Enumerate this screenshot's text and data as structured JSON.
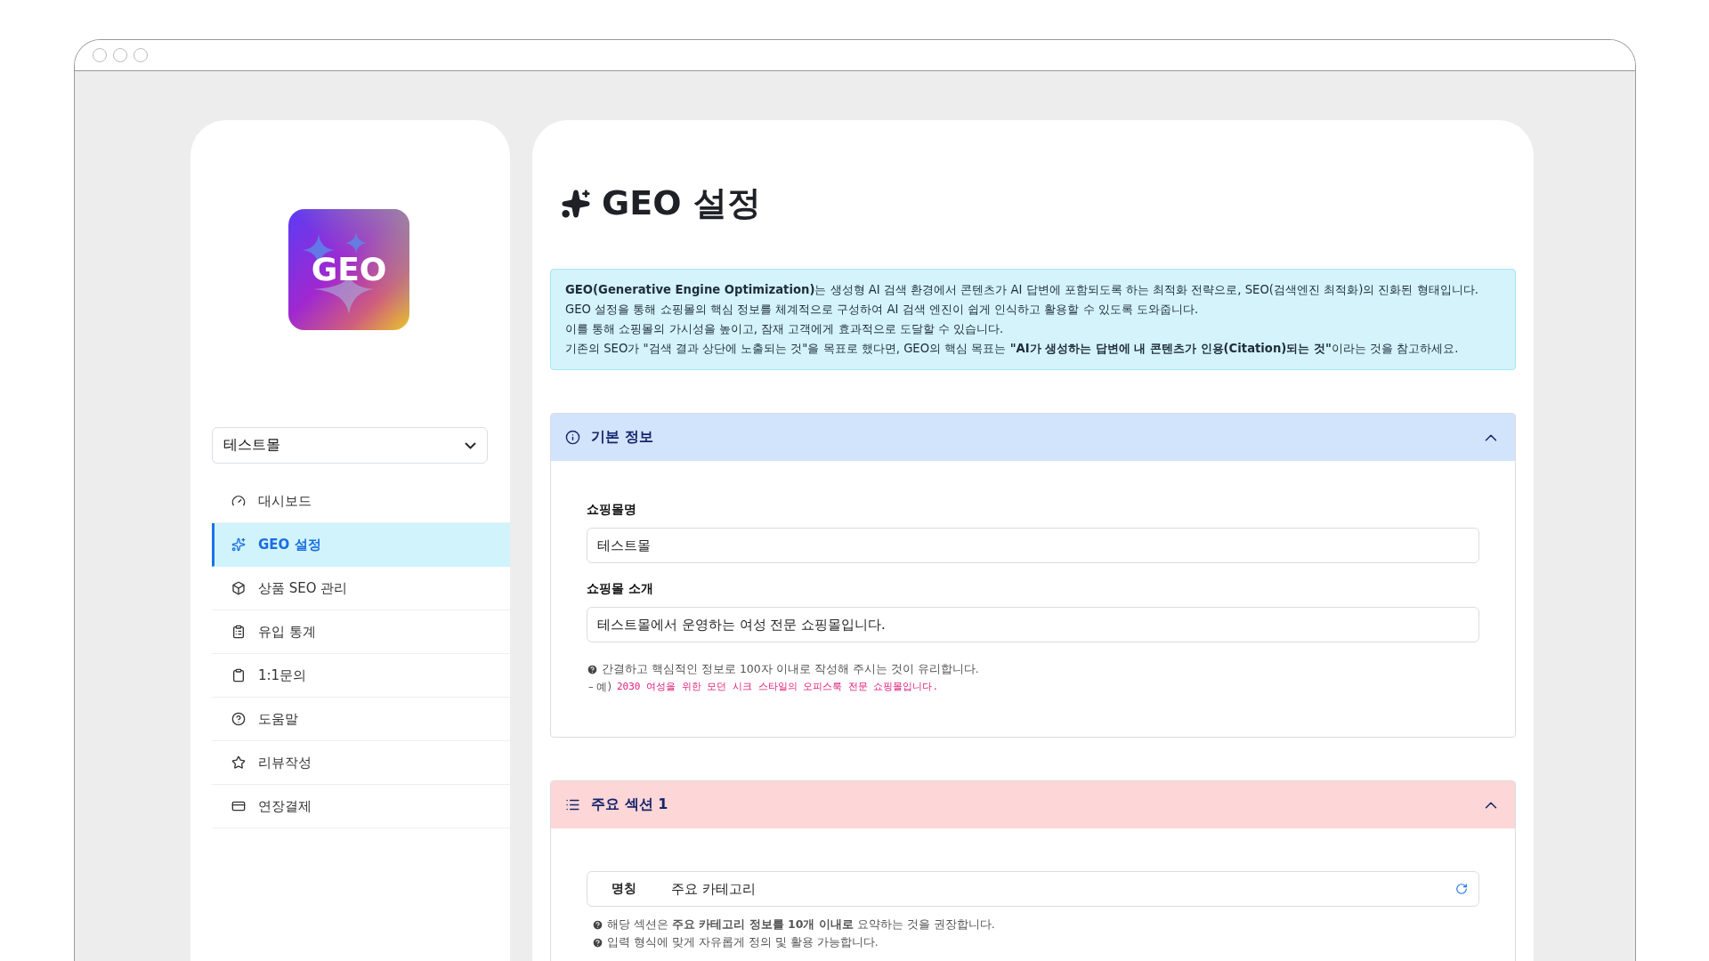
{
  "sidebar": {
    "logo": "GEO",
    "mall_select": {
      "value": "테스트몰"
    },
    "items": [
      {
        "label": "대시보드",
        "selected": false
      },
      {
        "label": "GEO 설정",
        "selected": true
      },
      {
        "label": "상품 SEO 관리",
        "selected": false
      },
      {
        "label": "유입 통계",
        "selected": false
      },
      {
        "label": "1:1문의",
        "selected": false
      },
      {
        "label": "도움말",
        "selected": false
      },
      {
        "label": "리뷰작성",
        "selected": false
      },
      {
        "label": "연장결제",
        "selected": false
      }
    ]
  },
  "page": {
    "title": "GEO 설정",
    "notice": [
      "**GEO(Generative Engine Optimization)**는 생성형 AI 검색 환경에서 콘텐츠가 AI 답변에 포함되도록 하는 최적화 전략으로, SEO(검색엔진 최적화)의 진화된 형태입니다.",
      "GEO 설정을 통해 쇼핑몰의 핵심 정보를 체계적으로 구성하여 AI 검색 엔진이 쉽게 인식하고 활용할 수 있도록 도와줍니다.",
      "이를 통해 쇼핑몰의 가시성을 높이고, 잠재 고객에게 효과적으로 도달할 수 있습니다.",
      "기존의 SEO가 \"검색 결과 상단에 노출되는 것\"을 목표로 했다면, GEO의 핵심 목표는 **\"AI가 생성하는 답변에 내 콘텐츠가 인용(Citation)되는 것\"**이라는 것을 참고하세요."
    ],
    "sections": [
      {
        "kind": "form",
        "title": "기본 정보",
        "color": "#d2e3fc",
        "expanded": true,
        "fields": [
          {
            "label": "쇼핑몰명",
            "value": "테스트몰"
          },
          {
            "label": "쇼핑몰 소개",
            "value": "테스트몰에서 운영하는 여성 전문 쇼핑몰입니다."
          }
        ],
        "hints": [
          "간결하고 핵심적인 정보로 100자 이내로 작성해 주시는 것이 유리합니다."
        ],
        "example": {
          "prefix": "– 예)",
          "text": "2030 여성을 위한 모던 시크 스타일의 오피스룩 전문 쇼핑몰입니다."
        }
      },
      {
        "kind": "named",
        "title": "주요 섹션 1",
        "color": "#fdd6d7",
        "expanded": true,
        "name_field": {
          "label": "명칭",
          "value": "주요 카테고리"
        },
        "hints": [
          "해당 섹션은 **주요 카테고리 정보를 10개 이내로** 요약하는 것을 권장합니다.",
          "입력 형식에 맞게 자유롭게 정의 및 활용 가능합니다."
        ]
      }
    ]
  }
}
